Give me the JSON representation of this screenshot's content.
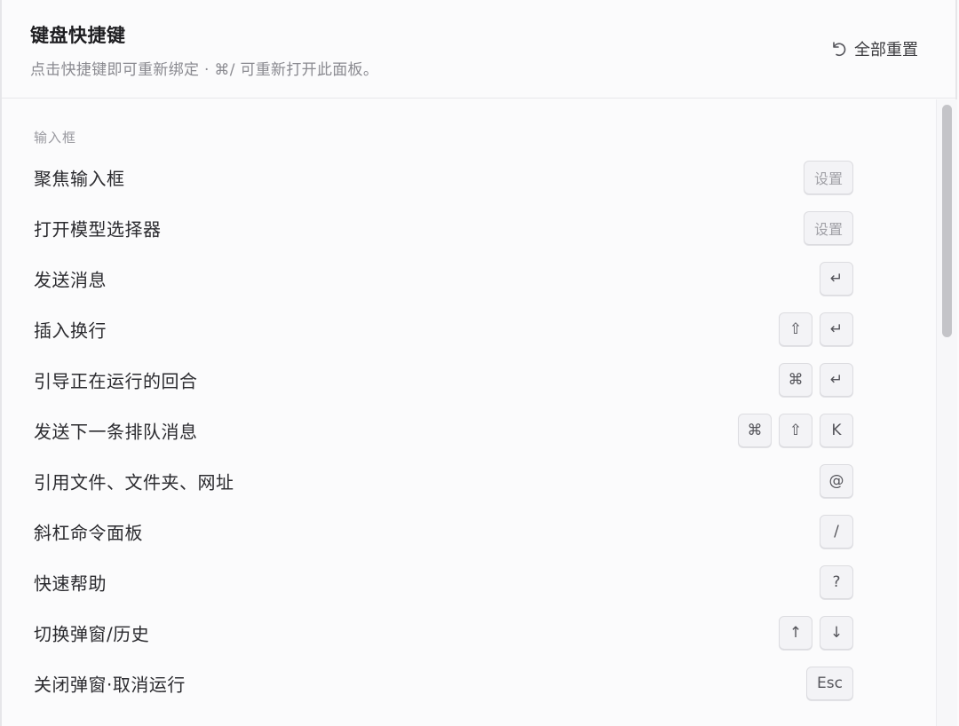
{
  "header": {
    "title": "键盘快捷键",
    "subtitle": "点击快捷键即可重新绑定 · ⌘/ 可重新打开此面板。",
    "reset_label": "全部重置"
  },
  "section": {
    "label": "输入框"
  },
  "shortcuts": [
    {
      "label": "聚焦输入框",
      "keys": [
        "设置"
      ],
      "unset": true
    },
    {
      "label": "打开模型选择器",
      "keys": [
        "设置"
      ],
      "unset": true
    },
    {
      "label": "发送消息",
      "keys": [
        "↵"
      ]
    },
    {
      "label": "插入换行",
      "keys": [
        "⇧",
        "↵"
      ]
    },
    {
      "label": "引导正在运行的回合",
      "keys": [
        "⌘",
        "↵"
      ]
    },
    {
      "label": "发送下一条排队消息",
      "keys": [
        "⌘",
        "⇧",
        "K"
      ]
    },
    {
      "label": "引用文件、文件夹、网址",
      "keys": [
        "@"
      ]
    },
    {
      "label": "斜杠命令面板",
      "keys": [
        "/"
      ]
    },
    {
      "label": "快速帮助",
      "keys": [
        "?"
      ]
    },
    {
      "label": "切换弹窗/历史",
      "keys": [
        "↑",
        "↓"
      ]
    },
    {
      "label": "关闭弹窗·取消运行",
      "keys": [
        "Esc"
      ]
    }
  ]
}
